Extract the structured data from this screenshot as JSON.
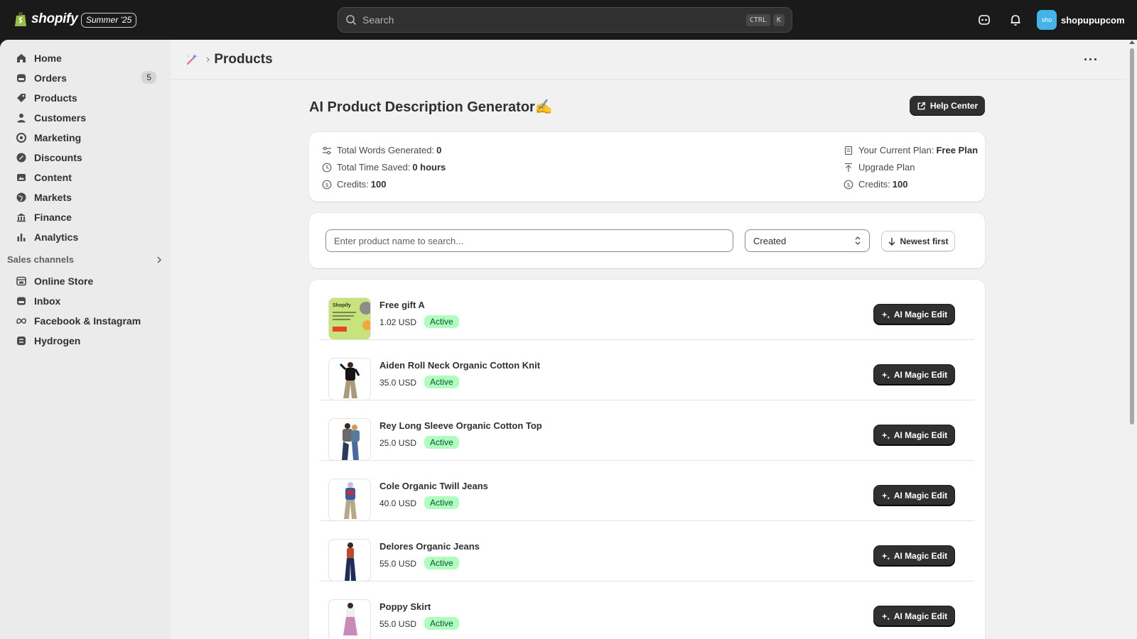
{
  "topbar": {
    "brand": "shopify",
    "edition": "Summer '25",
    "search_placeholder": "Search",
    "shortcut_keys": [
      "CTRL",
      "K"
    ],
    "store_avatar": "sho",
    "store_name": "shopupupcom"
  },
  "sidebar": {
    "items": [
      {
        "label": "Home",
        "icon": "home-icon"
      },
      {
        "label": "Orders",
        "icon": "orders-icon",
        "badge": "5"
      },
      {
        "label": "Products",
        "icon": "tag-icon"
      },
      {
        "label": "Customers",
        "icon": "person-icon"
      },
      {
        "label": "Marketing",
        "icon": "target-icon"
      },
      {
        "label": "Discounts",
        "icon": "discount-icon"
      },
      {
        "label": "Content",
        "icon": "content-icon"
      },
      {
        "label": "Markets",
        "icon": "globe-icon"
      },
      {
        "label": "Finance",
        "icon": "bank-icon"
      },
      {
        "label": "Analytics",
        "icon": "bar-chart-icon"
      }
    ],
    "sales_channels_title": "Sales channels",
    "channels": [
      {
        "label": "Online Store",
        "icon": "store-icon"
      },
      {
        "label": "Inbox",
        "icon": "inbox-icon"
      },
      {
        "label": "Facebook & Instagram",
        "icon": "meta-icon"
      },
      {
        "label": "Hydrogen",
        "icon": "hydrogen-icon"
      }
    ]
  },
  "page": {
    "breadcrumb_title": "Products",
    "app_title": "AI Product Description Generator✍️",
    "help_button": "Help Center"
  },
  "stats": {
    "words_label": "Total Words Generated:",
    "words_value": "0",
    "time_label": "Total Time Saved:",
    "time_value": "0 hours",
    "credits_label": "Credits:",
    "credits_value": "100",
    "plan_label": "Your Current Plan:",
    "plan_value": "Free Plan",
    "upgrade_label": "Upgrade Plan",
    "credits2_label": "Credits:",
    "credits2_value": "100"
  },
  "filters": {
    "search_placeholder": "Enter product name to search...",
    "sort_field": "Created",
    "sort_order": "Newest first"
  },
  "products": [
    {
      "name": "Free gift A",
      "price": "1.02 USD",
      "status": "Active",
      "action": "AI Magic Edit"
    },
    {
      "name": "Aiden Roll Neck Organic Cotton Knit",
      "price": "35.0 USD",
      "status": "Active",
      "action": "AI Magic Edit"
    },
    {
      "name": "Rey Long Sleeve Organic Cotton Top",
      "price": "25.0 USD",
      "status": "Active",
      "action": "AI Magic Edit"
    },
    {
      "name": "Cole Organic Twill Jeans",
      "price": "40.0 USD",
      "status": "Active",
      "action": "AI Magic Edit"
    },
    {
      "name": "Delores Organic Jeans",
      "price": "55.0 USD",
      "status": "Active",
      "action": "AI Magic Edit"
    },
    {
      "name": "Poppy Skirt",
      "price": "55.0 USD",
      "status": "Active",
      "action": "AI Magic Edit"
    }
  ],
  "thumb_text": "Shopify",
  "colors": {
    "topbar": "#1a1a1a",
    "accent_button": "#303030",
    "active_badge_bg": "#affebf",
    "active_badge_text": "#0c5132",
    "page_bg": "#f1f1f1"
  }
}
